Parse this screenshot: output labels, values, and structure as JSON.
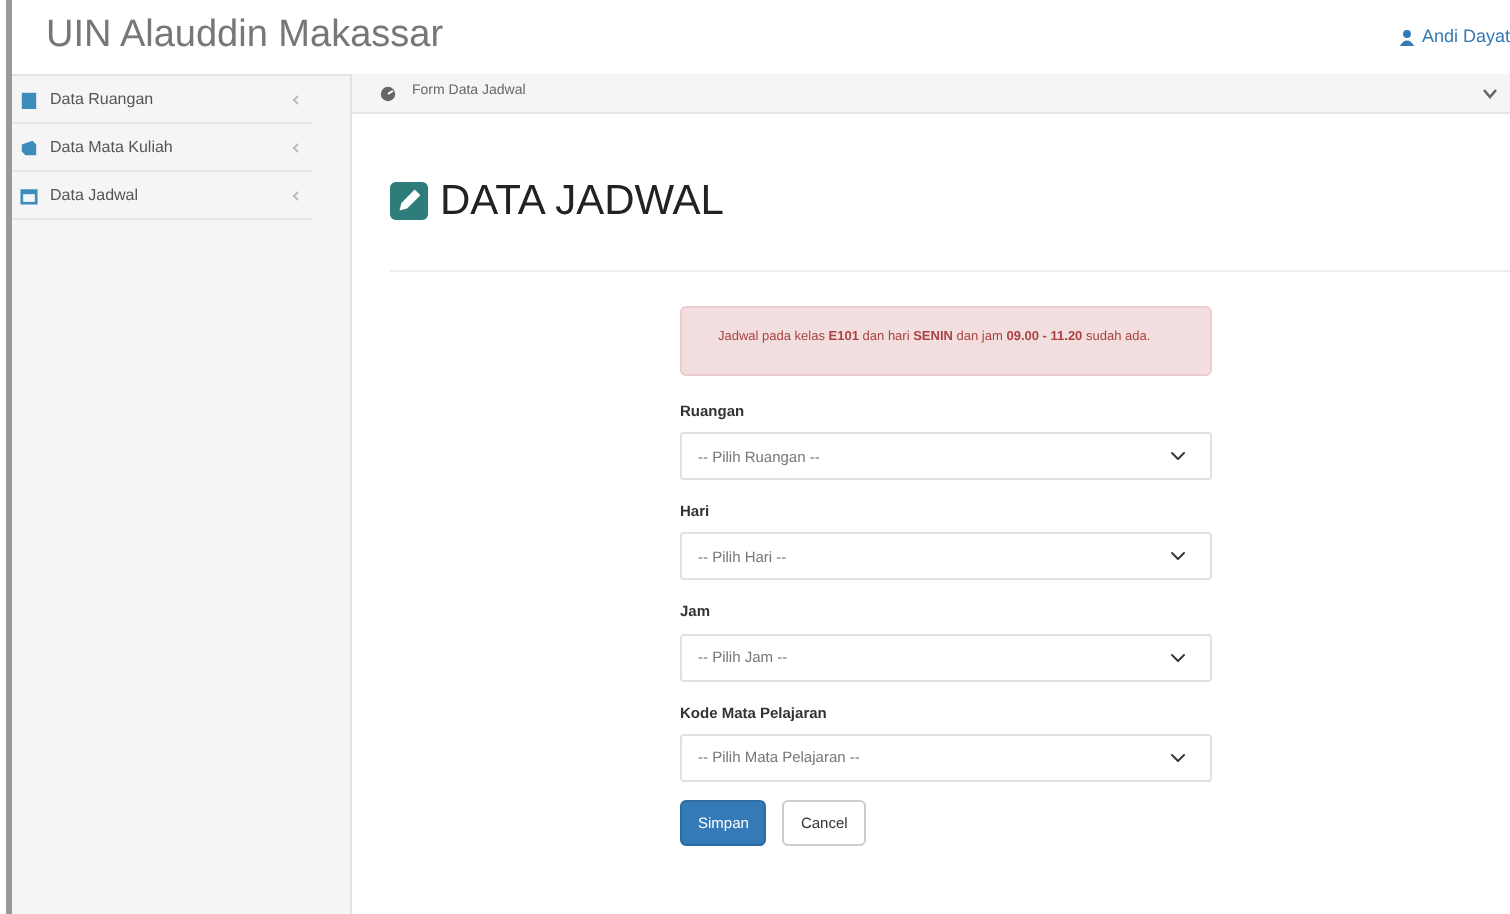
{
  "header": {
    "brand": "UIN Alauddin Makassar",
    "user": "Andi Dayat"
  },
  "sidebar": {
    "items": [
      {
        "label": "Data Ruangan",
        "color": "#3c8dbc"
      },
      {
        "label": "Data Mata Kuliah",
        "color": "#3c8dbc"
      },
      {
        "label": "Data Jadwal",
        "color": "#3c8dbc"
      }
    ]
  },
  "breadcrumb": "Form Data Jadwal",
  "page_title": "DATA JADWAL",
  "alert": "Jadwal pada kelas **E101** dan hari **SENIN** dan jam **09.00 - 11.20** sudah ada.",
  "form": {
    "fields": [
      {
        "label": "Ruangan",
        "value": "-- Pilih Ruangan --"
      },
      {
        "label": "Hari",
        "value": "-- Pilih Hari --"
      },
      {
        "label": "Jam",
        "value": "-- Pilih Jam --"
      },
      {
        "label": "Kode Mata Pelajaran",
        "value": "-- Pilih Mata Pelajaran --"
      }
    ]
  },
  "buttons": [
    {
      "label": "Simpan",
      "kind": "primary"
    },
    {
      "label": "Cancel",
      "kind": "default"
    }
  ]
}
